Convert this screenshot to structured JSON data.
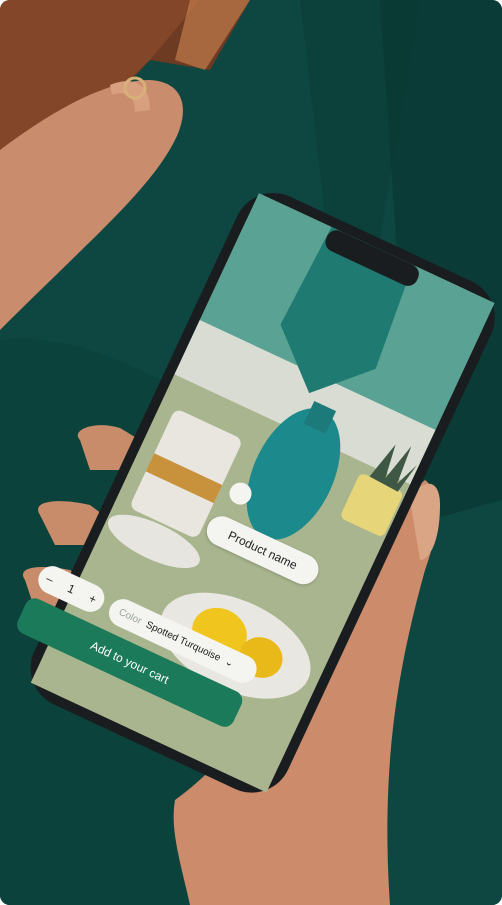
{
  "screen": {
    "product_name_tag": "Product name",
    "quantity": {
      "minus": "–",
      "value": "1",
      "plus": "+"
    },
    "color": {
      "label": "Color",
      "value": "Spotted Turquoise",
      "chevron": "⌄"
    },
    "add_to_cart_label": "Add to your cart"
  },
  "colors": {
    "background_fabric": "#0f4a44",
    "screen_green": "#a9b58f",
    "cta_green": "#1b7a5a",
    "pill_bg": "#f4f4f0"
  },
  "icons": {
    "hotspot": "hotspot-dot-icon",
    "chevron": "chevron-down-icon"
  }
}
